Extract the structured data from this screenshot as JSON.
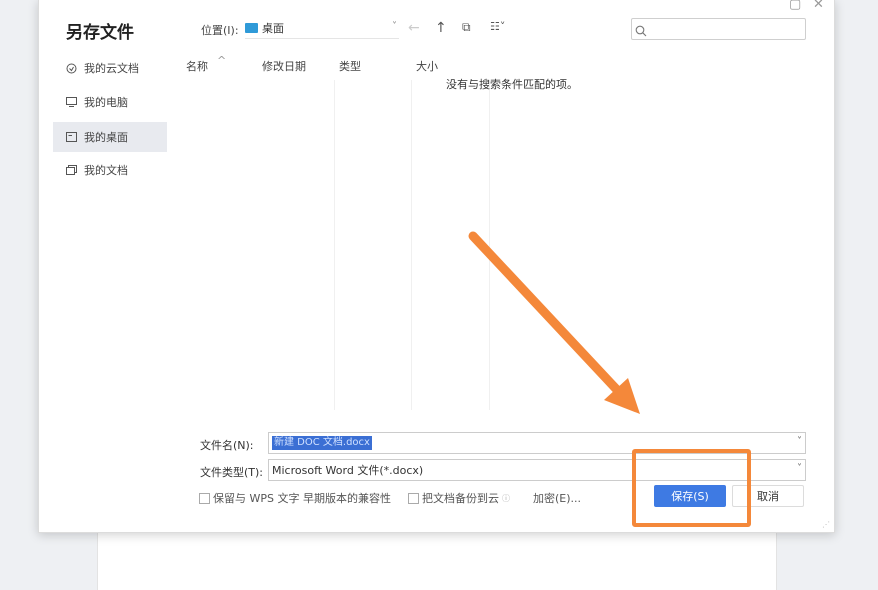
{
  "dialog": {
    "title": "另存文件",
    "close_glyph": "✕",
    "restore_glyph": "▢"
  },
  "sidebar": {
    "items": [
      {
        "label": "我的云文档",
        "icon": "cloud-doc-icon",
        "active": false
      },
      {
        "label": "我的电脑",
        "icon": "monitor-icon",
        "active": false
      },
      {
        "label": "我的桌面",
        "icon": "desktop-icon",
        "active": true
      },
      {
        "label": "我的文档",
        "icon": "documents-icon",
        "active": false
      }
    ]
  },
  "toolbar": {
    "location_label": "位置(I):",
    "location_value": "桌面",
    "back_glyph": "←",
    "up_glyph": "↑",
    "new_folder_glyph": "⧉",
    "view_glyph": "☷˅"
  },
  "columns": {
    "name": "名称",
    "sort_glyph": "^",
    "modified": "修改日期",
    "type": "类型",
    "size": "大小"
  },
  "file_list": {
    "empty_message": "没有与搜索条件匹配的项。"
  },
  "form": {
    "filename_label": "文件名(N):",
    "filename_value": "新建 DOC 文档.docx",
    "filetype_label": "文件类型(T):",
    "filetype_value": "Microsoft Word 文件(*.docx)"
  },
  "options": {
    "compat_label": "保留与 WPS 文字 早期版本的兼容性",
    "backup_label": "把文档备份到云",
    "encrypt_label": "加密(E)..."
  },
  "buttons": {
    "save_label": "保存(S)",
    "cancel_label": "取消"
  },
  "colors": {
    "accent": "#3e7ae3",
    "annotation": "#f4883a"
  }
}
